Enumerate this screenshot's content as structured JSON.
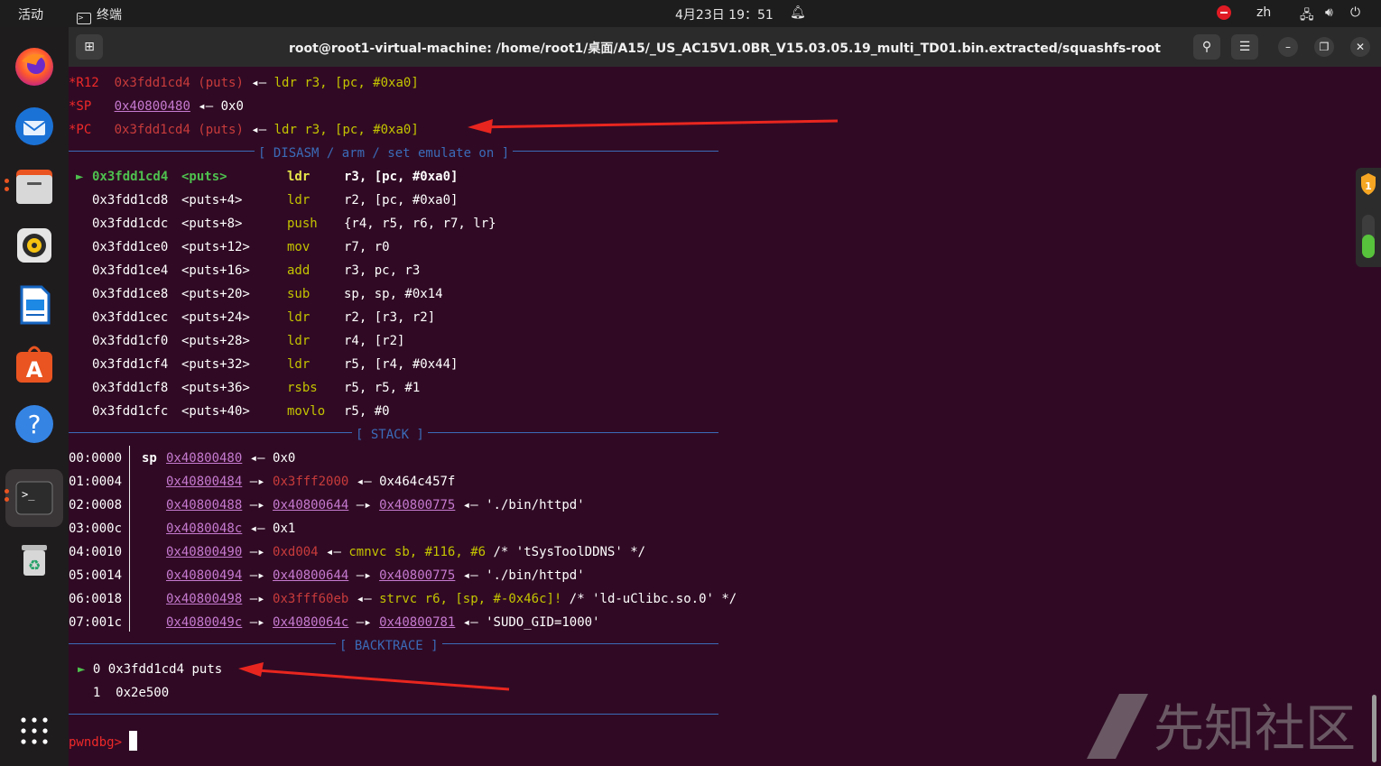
{
  "topbar": {
    "activities": "活动",
    "app_name": "终端",
    "datetime": "4月23日 19：51",
    "input_method": "zh"
  },
  "dock": {
    "apps": [
      "firefox-icon",
      "thunderbird-icon",
      "files-icon",
      "rhythmbox-icon",
      "writer-icon",
      "app-center-icon",
      "help-icon",
      "terminal-icon",
      "trash-icon"
    ]
  },
  "window": {
    "title": "root@root1-virtual-machine: /home/root1/桌面/A15/_US_AC15V1.0BR_V15.03.05.19_multi_TD01.bin.extracted/squashfs-root"
  },
  "registers": [
    {
      "name": "*R12",
      "value": "0x3fdd1cd4 (puts)",
      "arrow": "◂—",
      "rest": "ldr r3, [pc, #0xa0]"
    },
    {
      "name": "*SP",
      "value": "0x40800480",
      "arrow": "◂—",
      "rest": "0x0"
    },
    {
      "name": "*PC",
      "value": "0x3fdd1cd4 (puts)",
      "arrow": "◂—",
      "rest": "ldr r3, [pc, #0xa0]"
    }
  ],
  "sections": {
    "disasm": "[ DISASM / arm / set emulate on ]",
    "stack": "[ STACK ]",
    "backtrace": "[ BACKTRACE ]"
  },
  "disasm": [
    {
      "marker": "►",
      "addr": "0x3fdd1cd4",
      "sym": "<puts>",
      "op": "ldr",
      "args": "r3, [pc, #0xa0]",
      "current": true
    },
    {
      "marker": "",
      "addr": "0x3fdd1cd8",
      "sym": "<puts+4>",
      "op": "ldr",
      "args": "r2, [pc, #0xa0]",
      "current": false
    },
    {
      "marker": "",
      "addr": "0x3fdd1cdc",
      "sym": "<puts+8>",
      "op": "push",
      "args": "{r4, r5, r6, r7, lr}",
      "current": false
    },
    {
      "marker": "",
      "addr": "0x3fdd1ce0",
      "sym": "<puts+12>",
      "op": "mov",
      "args": "r7, r0",
      "current": false
    },
    {
      "marker": "",
      "addr": "0x3fdd1ce4",
      "sym": "<puts+16>",
      "op": "add",
      "args": "r3, pc, r3",
      "current": false
    },
    {
      "marker": "",
      "addr": "0x3fdd1ce8",
      "sym": "<puts+20>",
      "op": "sub",
      "args": "sp, sp, #0x14",
      "current": false
    },
    {
      "marker": "",
      "addr": "0x3fdd1cec",
      "sym": "<puts+24>",
      "op": "ldr",
      "args": "r2, [r3, r2]",
      "current": false
    },
    {
      "marker": "",
      "addr": "0x3fdd1cf0",
      "sym": "<puts+28>",
      "op": "ldr",
      "args": "r4, [r2]",
      "current": false
    },
    {
      "marker": "",
      "addr": "0x3fdd1cf4",
      "sym": "<puts+32>",
      "op": "ldr",
      "args": "r5, [r4, #0x44]",
      "current": false
    },
    {
      "marker": "",
      "addr": "0x3fdd1cf8",
      "sym": "<puts+36>",
      "op": "rsbs",
      "args": "r5, r5, #1",
      "current": false
    },
    {
      "marker": "",
      "addr": "0x3fdd1cfc",
      "sym": "<puts+40>",
      "op": "movlo",
      "args": "r5, #0",
      "current": false
    }
  ],
  "stack": [
    {
      "idx": "00:0000",
      "reg": "sp",
      "addr": "0x40800480",
      "a1": "◂—",
      "v1": "0x0",
      "v1c": "wht",
      "a2": "",
      "v2": "",
      "v2c": "",
      "a3": "",
      "v3": ""
    },
    {
      "idx": "01:0004",
      "reg": "",
      "addr": "0x40800484",
      "a1": "—▸",
      "v1": "0x3fff2000",
      "v1c": "dred",
      "a2": "◂—",
      "v2": "0x464c457f",
      "v2c": "wht",
      "a3": "",
      "v3": ""
    },
    {
      "idx": "02:0008",
      "reg": "",
      "addr": "0x40800488",
      "a1": "—▸",
      "v1": "0x40800644",
      "v1c": "ul",
      "a2": "—▸",
      "v2": "0x40800775",
      "v2c": "ul",
      "a3": "◂—",
      "v3": "'./bin/httpd'"
    },
    {
      "idx": "03:000c",
      "reg": "",
      "addr": "0x4080048c",
      "a1": "◂—",
      "v1": "0x1",
      "v1c": "wht",
      "a2": "",
      "v2": "",
      "v2c": "",
      "a3": "",
      "v3": ""
    },
    {
      "idx": "04:0010",
      "reg": "",
      "addr": "0x40800490",
      "a1": "—▸",
      "v1": "0xd004",
      "v1c": "dred",
      "a2": "◂—",
      "v2": "cmnvc sb, #116, #6",
      "v2c": "yel",
      "a3": "",
      "v3": "/* 'tSysToolDDNS' */"
    },
    {
      "idx": "05:0014",
      "reg": "",
      "addr": "0x40800494",
      "a1": "—▸",
      "v1": "0x40800644",
      "v1c": "ul",
      "a2": "—▸",
      "v2": "0x40800775",
      "v2c": "ul",
      "a3": "◂—",
      "v3": "'./bin/httpd'"
    },
    {
      "idx": "06:0018",
      "reg": "",
      "addr": "0x40800498",
      "a1": "—▸",
      "v1": "0x3fff60eb",
      "v1c": "dred",
      "a2": "◂—",
      "v2": "strvc r6, [sp, #-0x46c]!",
      "v2c": "yel",
      "a3": "",
      "v3": "/* 'ld-uClibc.so.0' */"
    },
    {
      "idx": "07:001c",
      "reg": "",
      "addr": "0x4080049c",
      "a1": "—▸",
      "v1": "0x4080064c",
      "v1c": "ul",
      "a2": "—▸",
      "v2": "0x40800781",
      "v2c": "ul",
      "a3": "◂—",
      "v3": "'SUDO_GID=1000'"
    }
  ],
  "backtrace": [
    {
      "marker": "►",
      "num": "0",
      "addr": "0x3fdd1cd4",
      "sym": "puts"
    },
    {
      "marker": "",
      "num": "1",
      "addr": "0x2e500",
      "sym": ""
    }
  ],
  "prompt": "pwndbg>",
  "watermark": "先知社区",
  "shield_badge": "1"
}
